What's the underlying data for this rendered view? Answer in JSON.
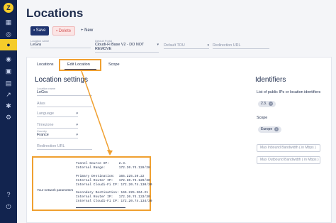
{
  "page": {
    "title": "Locations"
  },
  "toolbar": {
    "save_label": "Save",
    "delete_label": "Delete",
    "new_label": "New"
  },
  "header_fields": {
    "location_name": {
      "label": "Location name",
      "value": "LeGra"
    },
    "default_portal": {
      "label": "Default Portal",
      "value": "Cloudi-Fi Base V2 - DO NOT REMOVE"
    },
    "default_tou": {
      "placeholder": "Default TOU"
    },
    "redirection_url": {
      "placeholder": "Redirection URL"
    }
  },
  "tabs": [
    {
      "label": "Locations"
    },
    {
      "label": "Edit Location"
    },
    {
      "label": "Scope"
    }
  ],
  "location_settings": {
    "title": "Location settings",
    "location_name": {
      "label": "Location name",
      "value": "LeGra"
    },
    "alias": {
      "placeholder": "Alias"
    },
    "language": {
      "placeholder": "Language"
    },
    "timezone": {
      "placeholder": "Timezone"
    },
    "country": {
      "label": "Country",
      "value": "France"
    },
    "redirection_url": {
      "placeholder": "Redirection URL"
    }
  },
  "identifiers": {
    "title": "Identifiers",
    "list_label": "List of public IPs or location identifiers",
    "ip_chip": "2.3.",
    "scope_label": "Scope",
    "scope_chip": "Europe",
    "inbound_placeholder": "Max Inbound Bandwidth ( in Mbps )",
    "outbound_placeholder": "Max Outbound Bandwidth ( in Mbps )"
  },
  "popup": {
    "side_label": "Your network parameters",
    "lines": [
      "Tunnel Source IP:     2.3.",
      "Internal Range:       172.20.74.128/28",
      "",
      "Primary Destination:  165.225.20.22",
      "Internal Router IP:   172.20.74.129/30",
      "Internal Cloudi-Fi IP: 172.20.74.130/30",
      "",
      "Secondary Destination: 165.225.204.21",
      "Internal Router IP:   172.20.74.133/30",
      "Internal Cloudi-Fi IP: 172.20.74.134/30"
    ]
  },
  "colors": {
    "sidebar": "#12244f",
    "accent": "#f5cc2a",
    "highlight": "#f0a030",
    "primary_button": "#1f3470"
  },
  "icons": [
    "logo-icon",
    "dashboard-icon",
    "portal-icon",
    "location-icon",
    "users-icon",
    "camera-icon",
    "chart-icon",
    "group-icon",
    "settings-icon",
    "help-icon",
    "logout-icon"
  ]
}
